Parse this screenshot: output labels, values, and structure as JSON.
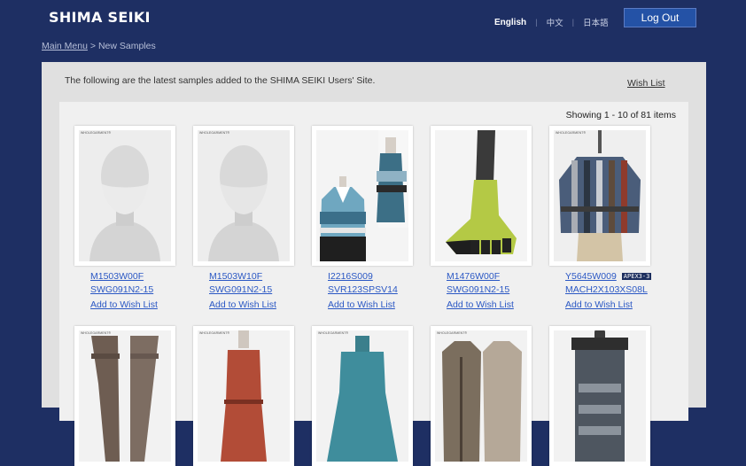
{
  "header": {
    "logo": "SHIMA SEIKI",
    "languages": [
      {
        "label": "English",
        "active": true
      },
      {
        "label": "中文",
        "active": false
      },
      {
        "label": "日本語",
        "active": false
      }
    ],
    "separator": "|",
    "logout_label": "Log Out"
  },
  "breadcrumb": {
    "main_menu": "Main Menu",
    "separator": ">",
    "current": "New Samples"
  },
  "content": {
    "intro": "The following are the latest samples added to the SHIMA SEIKI Users' Site.",
    "wish_list_link": "Wish List",
    "showing": "Showing 1 - 10 of 81 items"
  },
  "products": [
    {
      "code1": "M1503W00F",
      "code2": "SWG091N2-15",
      "badge": "",
      "wish": "Add to Wish List",
      "logo_text": "WHOLEGARMENT®",
      "image": "mask-mannequin"
    },
    {
      "code1": "M1503W10F",
      "code2": "SWG091N2-15",
      "badge": "",
      "wish": "Add to Wish List",
      "logo_text": "WHOLEGARMENT®",
      "image": "mask-mannequin"
    },
    {
      "code1": "I2216S009",
      "code2": "SVR123SPSV14",
      "badge": "",
      "wish": "Add to Wish List",
      "logo_text": "",
      "image": "polo-shirt"
    },
    {
      "code1": "M1476W00F",
      "code2": "SWG091N2-15",
      "badge": "",
      "wish": "Add to Wish List",
      "logo_text": "",
      "image": "toe-sock"
    },
    {
      "code1": "Y5645W009",
      "code2": "MACH2X103XS08L",
      "badge": "APEX3-3",
      "wish": "Add to Wish List",
      "logo_text": "WHOLEGARMENT®",
      "image": "patterned-top"
    },
    {
      "code1": "",
      "code2": "",
      "badge": "",
      "wish": "",
      "logo_text": "WHOLEGARMENT®",
      "image": "pants"
    },
    {
      "code1": "",
      "code2": "",
      "badge": "",
      "wish": "",
      "logo_text": "WHOLEGARMENT®",
      "image": "red-dress"
    },
    {
      "code1": "",
      "code2": "",
      "badge": "",
      "wish": "",
      "logo_text": "WHOLEGARMENT®",
      "image": "teal-dress"
    },
    {
      "code1": "",
      "code2": "",
      "badge": "",
      "wish": "",
      "logo_text": "WHOLEGARMENT®",
      "image": "long-cardigans"
    },
    {
      "code1": "",
      "code2": "",
      "badge": "",
      "wish": "",
      "logo_text": "",
      "image": "hanging-sample"
    }
  ],
  "colors": {
    "page_background": "#1e2f63",
    "logout_button": "#2452a6",
    "link": "#2b58c4",
    "panel": "#e0e0e0",
    "inner_panel": "#f0f0f0"
  }
}
